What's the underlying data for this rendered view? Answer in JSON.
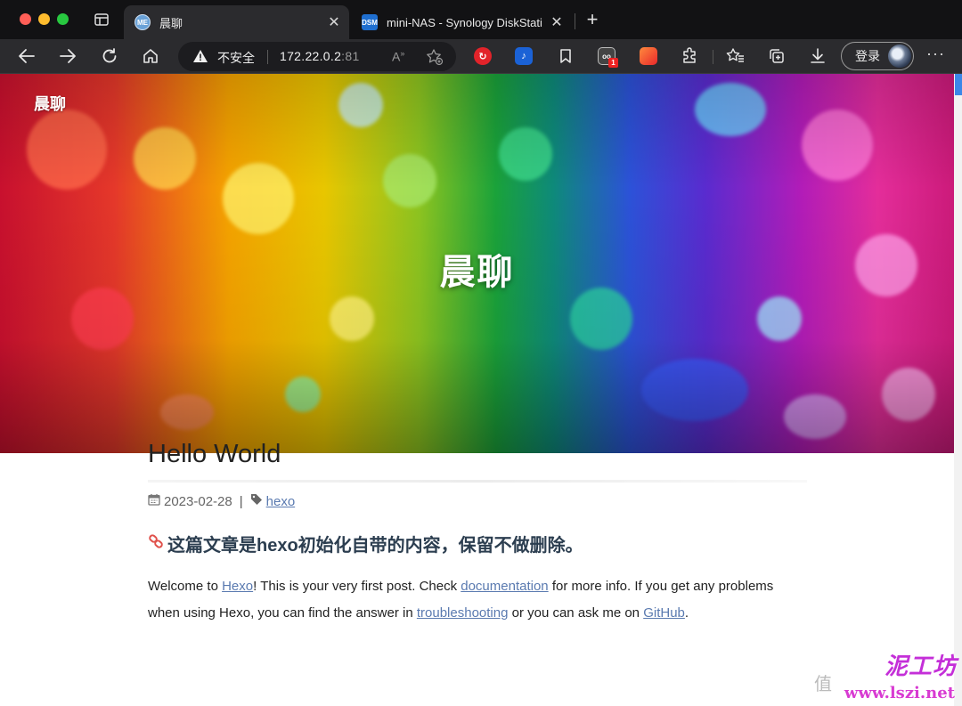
{
  "browser": {
    "tabs": [
      {
        "title": "晨聊",
        "favicon": "ME",
        "active": true
      },
      {
        "title": "mini-NAS - Synology DiskStati",
        "favicon": "DSM",
        "active": false
      }
    ],
    "omnibox": {
      "security_label": "不安全",
      "host": "172.22.0.2",
      "port": ":81"
    },
    "extension_badge": "1",
    "login_label": "登录",
    "icons": [
      "back-icon",
      "forward-icon",
      "reload-icon",
      "home-icon",
      "read-aloud-icon",
      "favorite-add-icon",
      "favorites-icon",
      "collections-icon",
      "download-icon",
      "extensions-icon",
      "more-icon"
    ]
  },
  "site": {
    "brand": "晨聊",
    "hero_title": "晨聊"
  },
  "post": {
    "title": "Hello World",
    "date": "2023-02-28",
    "meta_separator": "|",
    "tag": "hexo",
    "heading": "这篇文章是hexo初始化自带的内容，保留不做删除。",
    "paragraph": {
      "t1": "Welcome to ",
      "link_hexo": "Hexo",
      "t2": "! This is your very first post. Check ",
      "link_docs": "documentation",
      "t3": " for more info. If you get any problems when using Hexo, you can find the answer in ",
      "link_trouble": "troubleshooting",
      "t4": " or you can ask me on ",
      "link_github": "GitHub",
      "t5": "."
    }
  },
  "watermark": {
    "site": "www.lszi.net",
    "cn": "泥工坊",
    "side": "值"
  },
  "colors": {
    "accent_link": "#5a7ab0",
    "chrome_bg": "#2b2b2e",
    "tabbar_bg": "#121214"
  }
}
